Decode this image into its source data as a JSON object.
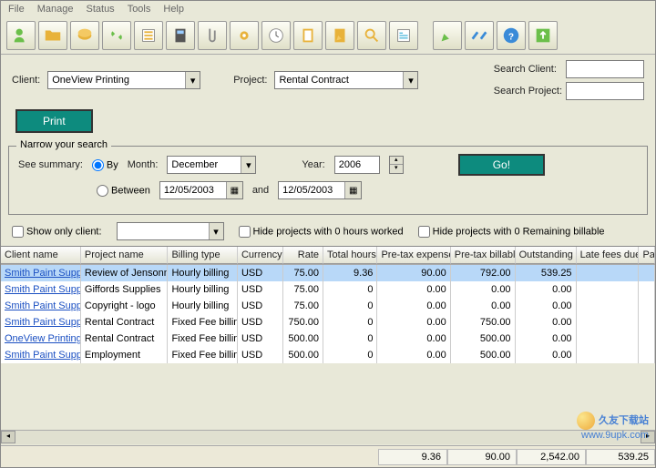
{
  "menu": [
    "File",
    "Manage",
    "Status",
    "Tools",
    "Help"
  ],
  "filters": {
    "client_label": "Client:",
    "client_value": "OneView Printing",
    "project_label": "Project:",
    "project_value": "Rental Contract",
    "search_client_label": "Search Client:",
    "search_project_label": "Search Project:"
  },
  "buttons": {
    "print": "Print",
    "go": "Go!"
  },
  "narrow": {
    "legend": "Narrow your search",
    "see_summary": "See summary:",
    "by": "By",
    "month_label": "Month:",
    "month_value": "December",
    "year_label": "Year:",
    "year_value": "2006",
    "between": "Between",
    "date1": "12/05/2003",
    "and": "and",
    "date2": "12/05/2003",
    "show_only_client": "Show only client:",
    "hide_zero_hours": "Hide projects with 0 hours worked",
    "hide_zero_billable": "Hide projects with 0 Remaining billable"
  },
  "grid": {
    "headers": [
      "Client name",
      "Project name",
      "Billing type",
      "Currency",
      "Rate",
      "Total hours",
      "Pre-tax expenses",
      "Pre-tax billable",
      "Outstanding",
      "Late fees due",
      "Pa"
    ],
    "rows": [
      {
        "client": "Smith Paint Supply",
        "project": "Review of Jensonn",
        "billing": "Hourly billing",
        "curr": "USD",
        "rate": "75.00",
        "hours": "9.36",
        "exp": "90.00",
        "bill": "792.00",
        "out": "539.25",
        "late": ""
      },
      {
        "client": "Smith Paint Supply",
        "project": "Giffords Supplies",
        "billing": "Hourly billing",
        "curr": "USD",
        "rate": "75.00",
        "hours": "0",
        "exp": "0.00",
        "bill": "0.00",
        "out": "0.00",
        "late": ""
      },
      {
        "client": "Smith Paint Supply",
        "project": "Copyright - logo",
        "billing": "Hourly billing",
        "curr": "USD",
        "rate": "75.00",
        "hours": "0",
        "exp": "0.00",
        "bill": "0.00",
        "out": "0.00",
        "late": ""
      },
      {
        "client": "Smith Paint Supply",
        "project": "Rental Contract",
        "billing": "Fixed Fee billin",
        "curr": "USD",
        "rate": "750.00",
        "hours": "0",
        "exp": "0.00",
        "bill": "750.00",
        "out": "0.00",
        "late": ""
      },
      {
        "client": "OneView Printing",
        "project": "Rental Contract",
        "billing": "Fixed Fee billin",
        "curr": "USD",
        "rate": "500.00",
        "hours": "0",
        "exp": "0.00",
        "bill": "500.00",
        "out": "0.00",
        "late": ""
      },
      {
        "client": "Smith Paint Supply",
        "project": "Employment",
        "billing": "Fixed Fee billin",
        "curr": "USD",
        "rate": "500.00",
        "hours": "0",
        "exp": "0.00",
        "bill": "500.00",
        "out": "0.00",
        "late": ""
      }
    ]
  },
  "footer_totals": [
    "9.36",
    "90.00",
    "2,542.00",
    "539.25"
  ],
  "watermark": {
    "l1": "久友下载站",
    "l2": "www.9upk.com"
  }
}
